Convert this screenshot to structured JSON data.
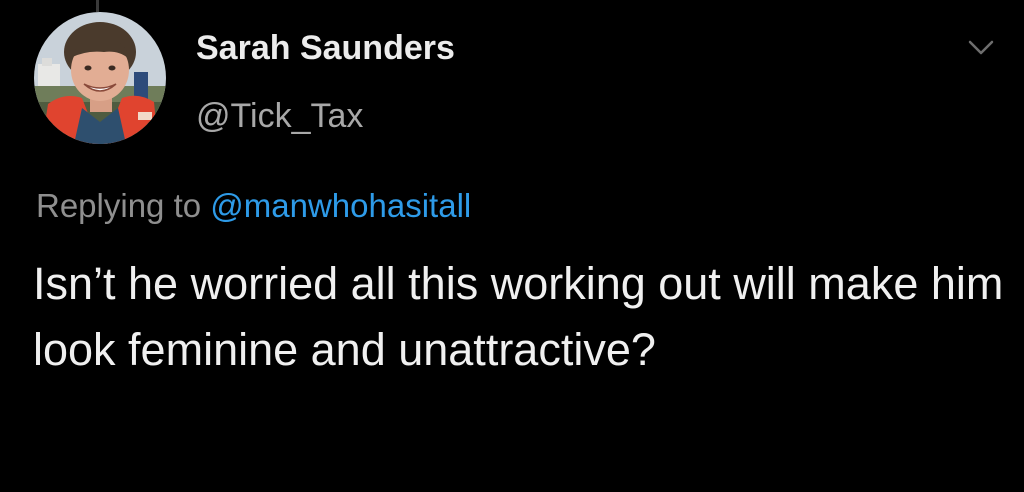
{
  "tweet": {
    "author": {
      "display_name": "Sarah Saunders",
      "handle": "@Tick_Tax",
      "avatar_icon": "user-avatar-photo"
    },
    "menu_icon": "chevron-down-icon",
    "reply_context": {
      "prefix": "Replying to",
      "mention": "@manwhohasitall"
    },
    "text": "Isn’t he worried all this working out will make him look feminine and unattractive?"
  },
  "colors": {
    "background": "#000000",
    "display_name": "#ececec",
    "handle": "#a8a8a8",
    "reply_prefix": "#8f8f8f",
    "mention_link": "#2e9be8",
    "body_text": "#f0f0f0",
    "chevron": "#6e6e6e"
  }
}
